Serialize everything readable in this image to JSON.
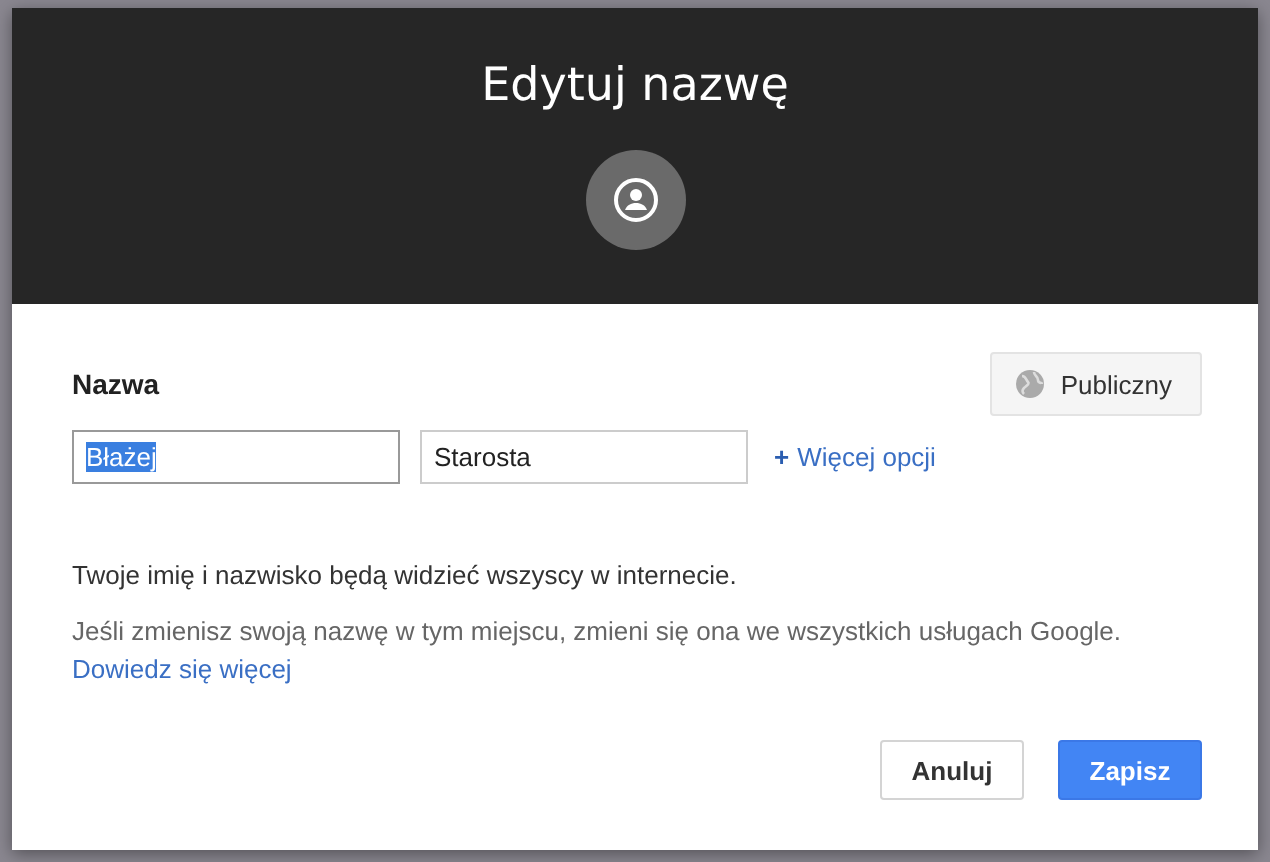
{
  "dialog": {
    "title": "Edytuj nazwę"
  },
  "name_label": "Nazwa",
  "visibility_button": "Publiczny",
  "fields": [
    {
      "value": "Błażej",
      "highlighted": true
    },
    {
      "value": "Starosta",
      "highlighted": false
    }
  ],
  "more_options_link": {
    "icon": "+",
    "label": "Więcej opcji"
  },
  "notice": "Twoje imię i nazwisko będą widzieć wszyscy w internecie.",
  "info": "Jeśli zmienisz swoją nazwę w tym miejscu, zmieni się ona we wszystkich usługach Google.",
  "learn_more_link": "Dowiedz się więcej",
  "buttons": [
    {
      "label": "Anuluj",
      "kind": "secondary"
    },
    {
      "label": "Zapisz",
      "kind": "primary"
    }
  ]
}
